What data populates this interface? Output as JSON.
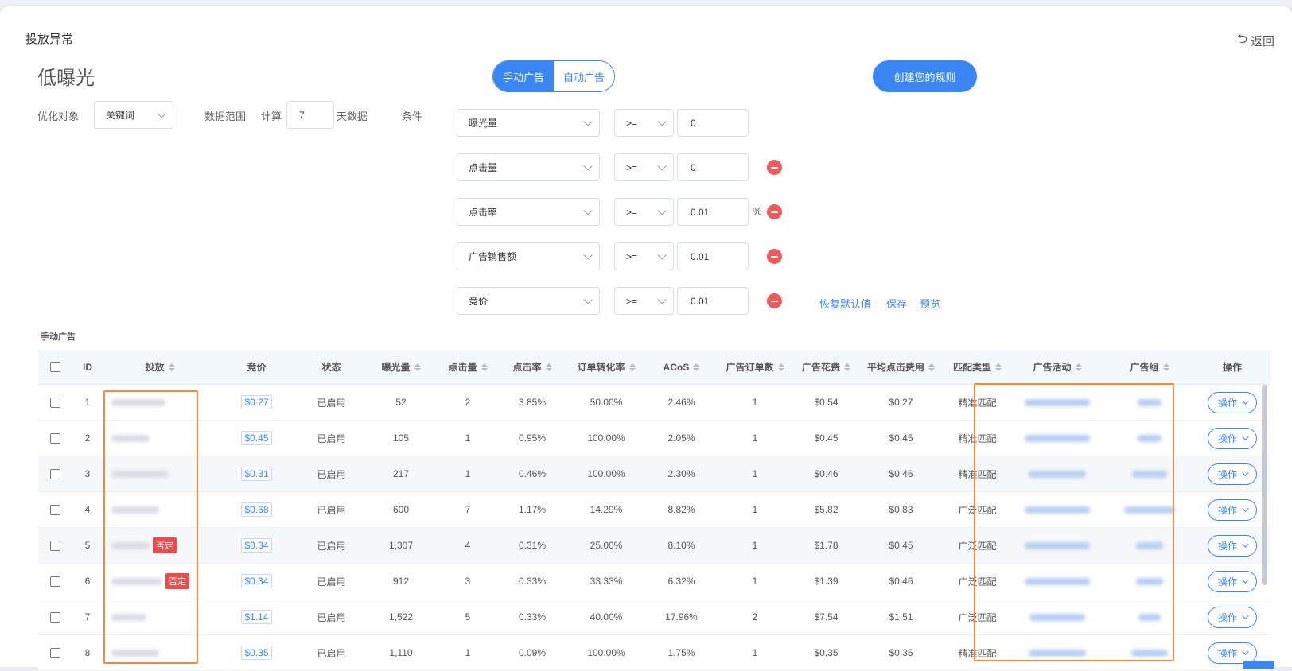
{
  "header": {
    "title": "投放异常",
    "back_label": "返回",
    "page_title": "低曝光"
  },
  "tabs": [
    {
      "label": "手动广告",
      "active": true
    },
    {
      "label": "自动广告",
      "active": false
    }
  ],
  "create_rule_label": "创建您的规则",
  "filters": {
    "target_label": "优化对象",
    "target_value": "关键词",
    "range_label": "数据范围",
    "calc_label": "计算",
    "days_value": "7",
    "days_suffix": "天数据",
    "condition_label": "条件",
    "conditions": [
      {
        "metric": "曝光量",
        "op": ">=",
        "value": "0",
        "removable": false,
        "unit": ""
      },
      {
        "metric": "点击量",
        "op": ">=",
        "value": "0",
        "removable": true,
        "unit": ""
      },
      {
        "metric": "点击率",
        "op": ">=",
        "value": "0.01",
        "removable": true,
        "unit": "%"
      },
      {
        "metric": "广告销售额",
        "op": ">=",
        "value": "0.01",
        "removable": true,
        "unit": ""
      },
      {
        "metric": "竞价",
        "op": ">=",
        "value": "0.01",
        "removable": true,
        "unit": ""
      }
    ],
    "actions": {
      "reset": "恢复默认值",
      "save": "保存",
      "preview": "预览"
    }
  },
  "section_label": "手动广告",
  "table": {
    "columns": [
      "ID",
      "投放",
      "竞价",
      "状态",
      "曝光量",
      "点击量",
      "点击率",
      "订单转化率",
      "ACoS",
      "广告订单数",
      "广告花费",
      "平均点击费用",
      "匹配类型",
      "广告活动",
      "广告组",
      "操作"
    ],
    "op_label": "操作",
    "neg_label": "否定",
    "rows": [
      {
        "id": "1",
        "bid": "$0.27",
        "status": "已启用",
        "imp": "52",
        "clk": "2",
        "ctr": "3.85%",
        "cvr": "50.00%",
        "acos": "2.46%",
        "orders": "1",
        "spend": "$0.54",
        "cpc": "$0.27",
        "match": "精准匹配",
        "neg": false
      },
      {
        "id": "2",
        "bid": "$0.45",
        "status": "已启用",
        "imp": "105",
        "clk": "1",
        "ctr": "0.95%",
        "cvr": "100.00%",
        "acos": "2.05%",
        "orders": "1",
        "spend": "$0.45",
        "cpc": "$0.45",
        "match": "精准匹配",
        "neg": false
      },
      {
        "id": "3",
        "bid": "$0.31",
        "status": "已启用",
        "imp": "217",
        "clk": "1",
        "ctr": "0.46%",
        "cvr": "100.00%",
        "acos": "2.30%",
        "orders": "1",
        "spend": "$0.46",
        "cpc": "$0.46",
        "match": "精准匹配",
        "neg": false
      },
      {
        "id": "4",
        "bid": "$0.68",
        "status": "已启用",
        "imp": "600",
        "clk": "7",
        "ctr": "1.17%",
        "cvr": "14.29%",
        "acos": "8.82%",
        "orders": "1",
        "spend": "$5.82",
        "cpc": "$0.83",
        "match": "广泛匹配",
        "neg": false
      },
      {
        "id": "5",
        "bid": "$0.34",
        "status": "已启用",
        "imp": "1,307",
        "clk": "4",
        "ctr": "0.31%",
        "cvr": "25.00%",
        "acos": "8.10%",
        "orders": "1",
        "spend": "$1.78",
        "cpc": "$0.45",
        "match": "广泛匹配",
        "neg": true
      },
      {
        "id": "6",
        "bid": "$0.34",
        "status": "已启用",
        "imp": "912",
        "clk": "3",
        "ctr": "0.33%",
        "cvr": "33.33%",
        "acos": "6.32%",
        "orders": "1",
        "spend": "$1.39",
        "cpc": "$0.46",
        "match": "广泛匹配",
        "neg": true
      },
      {
        "id": "7",
        "bid": "$1.14",
        "status": "已启用",
        "imp": "1,522",
        "clk": "5",
        "ctr": "0.33%",
        "cvr": "40.00%",
        "acos": "17.96%",
        "orders": "2",
        "spend": "$7.54",
        "cpc": "$1.51",
        "match": "广泛匹配",
        "neg": false
      },
      {
        "id": "8",
        "bid": "$0.35",
        "status": "已启用",
        "imp": "1,110",
        "clk": "1",
        "ctr": "0.09%",
        "cvr": "100.00%",
        "acos": "1.75%",
        "orders": "1",
        "spend": "$0.35",
        "cpc": "$0.35",
        "match": "精准匹配",
        "neg": false
      }
    ]
  },
  "colors": {
    "accent": "#3a86f5",
    "danger": "#f15a5a",
    "highlight": "#f28a3a"
  }
}
